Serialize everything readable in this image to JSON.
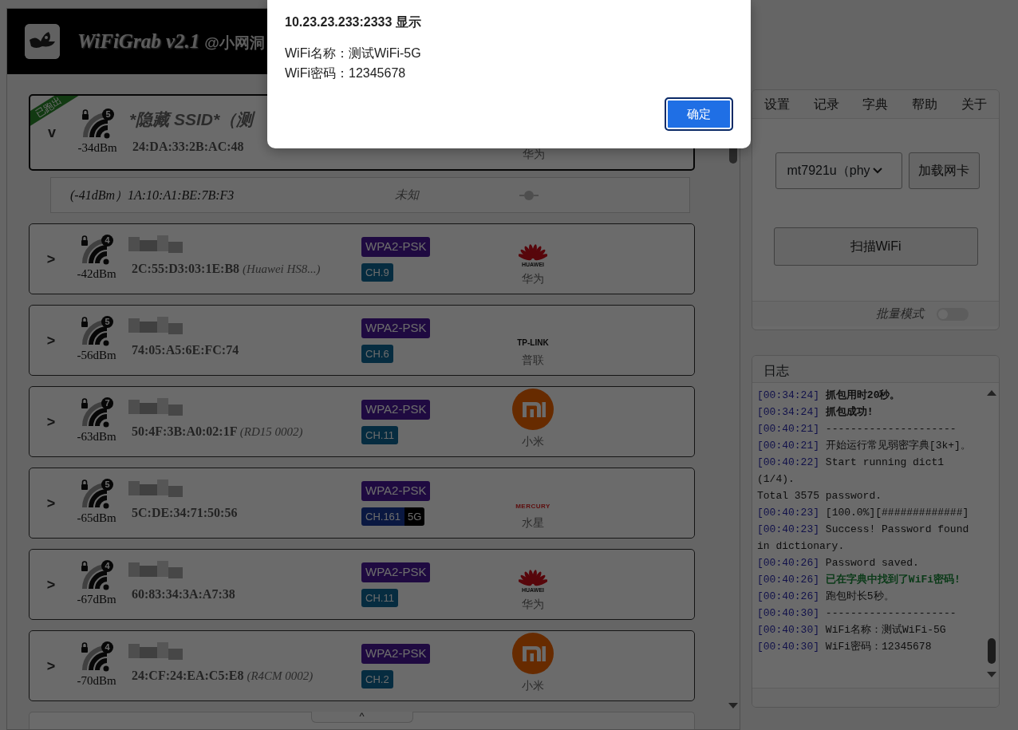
{
  "header": {
    "title": "WiFiGrab v2.1",
    "author": "@小网洞"
  },
  "networks": [
    {
      "expanded": true,
      "toggle": "v",
      "ribbon": "已跑出",
      "clients": "5",
      "rssi": "-34dBm",
      "ssid": "*隐藏 SSID*（测",
      "mac": "24:DA:33:2B:AC:48",
      "vendor": "华为",
      "sub_rows": [
        {
          "rssi": "(-41dBm）",
          "mac": "1A:10:A1:BE:7B:F3",
          "vendor": "未知"
        }
      ]
    },
    {
      "expanded": false,
      "toggle": ">",
      "clients": "4",
      "rssi": "-42dBm",
      "mac": "2C:55:D3:03:1E:B8",
      "model": "(Huawei HS8...)",
      "security": "WPA2-PSK",
      "channel": "CH.9",
      "vendor": "华为",
      "logo": {
        "kind": "huawei",
        "text": "HUAWEI"
      }
    },
    {
      "expanded": false,
      "toggle": ">",
      "clients": "5",
      "rssi": "-56dBm",
      "mac": "74:05:A5:6E:FC:74",
      "security": "WPA2-PSK",
      "channel": "CH.6",
      "vendor": "普联",
      "logo": {
        "kind": "tplink",
        "text": "TP-LINK"
      }
    },
    {
      "expanded": false,
      "toggle": ">",
      "clients": "7",
      "rssi": "-63dBm",
      "mac": "50:4F:3B:A0:02:1F",
      "model": "(RD15 0002)",
      "security": "WPA2-PSK",
      "channel": "CH.11",
      "vendor": "小米",
      "logo": {
        "kind": "mi"
      }
    },
    {
      "expanded": false,
      "toggle": ">",
      "clients": "5",
      "rssi": "-65dBm",
      "mac": "5C:DE:34:71:50:56",
      "security": "WPA2-PSK",
      "channel": "CH.161",
      "band": "5G",
      "vendor": "水星",
      "logo": {
        "kind": "mercury",
        "text": "MERCURY"
      }
    },
    {
      "expanded": false,
      "toggle": ">",
      "clients": "4",
      "rssi": "-67dBm",
      "mac": "60:83:34:3A:A7:38",
      "security": "WPA2-PSK",
      "channel": "CH.11",
      "vendor": "华为",
      "logo": {
        "kind": "huawei",
        "text": "HUAWEI"
      }
    },
    {
      "expanded": false,
      "toggle": ">",
      "clients": "4",
      "rssi": "-70dBm",
      "mac": "24:CF:24:EA:C5:E8",
      "model": "(R4CM 0002)",
      "security": "WPA2-PSK",
      "channel": "CH.2",
      "vendor": "小米",
      "logo": {
        "kind": "mi"
      }
    }
  ],
  "collapse_button": "^",
  "menu": [
    "设置",
    "记录",
    "字典",
    "帮助",
    "关于"
  ],
  "adapter": {
    "value": "mt7921u（phy",
    "load_button": "加载网卡"
  },
  "scan_button": "扫描WiFi",
  "batch_mode": {
    "label": "批量模式",
    "on": false
  },
  "log": {
    "title": "日志",
    "entries": [
      {
        "time": "[00:34:24]",
        "text": "抓包用时20秒。",
        "kind": "bold"
      },
      {
        "time": "[00:34:24]",
        "text": "抓包成功!",
        "kind": "bold"
      },
      {
        "time": "[00:40:21]",
        "text": "---------------------",
        "kind": "normal"
      },
      {
        "time": "[00:40:21]",
        "text": "开始运行常见弱密字典[3k+]。",
        "kind": "normal"
      },
      {
        "time": "[00:40:22]",
        "text": "Start running dict1 (1/4).",
        "kind": "normal"
      },
      {
        "text": "Total 3575 password.",
        "kind": "normal"
      },
      {
        "time": "[00:40:23]",
        "text": "[100.0%][#############]",
        "kind": "normal"
      },
      {
        "time": "[00:40:23]",
        "text": "Success! Password found in dictionary.",
        "kind": "normal"
      },
      {
        "time": "[00:40:26]",
        "text": "Password saved.",
        "kind": "normal"
      },
      {
        "time": "[00:40:26]",
        "text": "已在字典中找到了WiFi密码!",
        "kind": "success"
      },
      {
        "time": "[00:40:26]",
        "text": "跑包时长5秒。",
        "kind": "normal"
      },
      {
        "time": "[00:40:30]",
        "text": "---------------------",
        "kind": "normal"
      },
      {
        "time": "[00:40:30]",
        "text": "WiFi名称：测试WiFi-5G",
        "kind": "normal"
      },
      {
        "time": "[00:40:30]",
        "text": "WiFi密码：12345678",
        "kind": "normal"
      }
    ]
  },
  "dialog": {
    "title": "10.23.23.233:2333 显示",
    "lines": [
      "WiFi名称：测试WiFi-5G",
      "WiFi密码：12345678"
    ],
    "button": "确定"
  }
}
